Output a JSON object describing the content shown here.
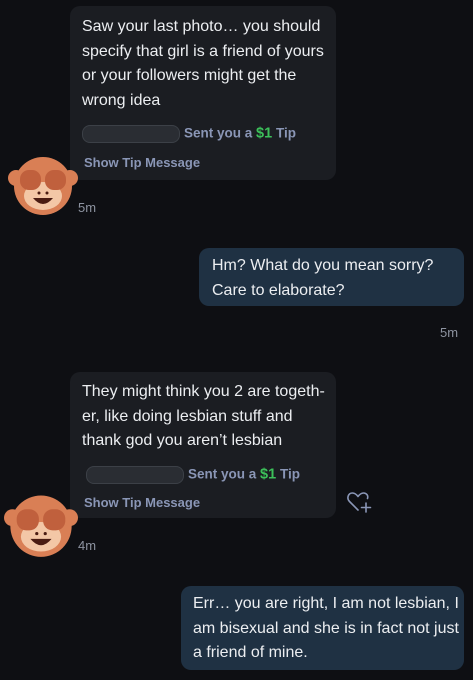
{
  "messages": [
    {
      "text": "Saw your last photo… you should\nspecify that girl is a friend of yours\nor your followers might get the\nwrong idea",
      "tip_prefix": "Sent you a",
      "tip_amount": "$1",
      "tip_suffix": "Tip",
      "show_tip": "Show Tip Message",
      "time": "5m",
      "avatar_icon": "see-no-evil-monkey-icon"
    },
    {
      "text": "Hm? What do you mean sorry?\nCare to elaborate?",
      "time": "5m"
    },
    {
      "text": "They might think you 2 are togeth-\ner, like doing lesbian stuff and\nthank god you aren’t lesbian",
      "tip_prefix": "Sent you a",
      "tip_amount": "$1",
      "tip_suffix": "Tip",
      "show_tip": "Show Tip Message",
      "time": "4m",
      "avatar_icon": "see-no-evil-monkey-icon",
      "like_icon": "heart-plus-icon"
    },
    {
      "text": "Err… you are right, I am not lesbian, I\nam bisexual and she is in fact not just\na friend of mine."
    }
  ],
  "colors": {
    "background": "#0e0f13",
    "incoming_bubble": "#1b1d22",
    "outgoing_bubble": "#1f3143",
    "tip_amount": "#3cc05a",
    "tip_text": "#8a96b6",
    "avatar": "#d97f55"
  }
}
